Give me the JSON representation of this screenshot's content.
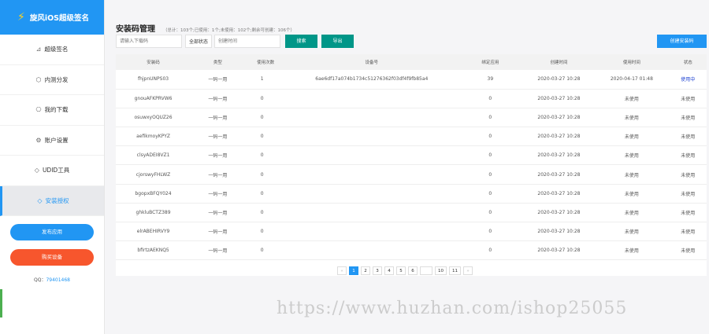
{
  "brand": {
    "title": "旋风iOS超级签名"
  },
  "sidebar": {
    "items": [
      {
        "label": "超级签名",
        "icon": "⊿"
      },
      {
        "label": "内测分发",
        "icon": "⬡"
      },
      {
        "label": "我的下载",
        "icon": "⎔"
      },
      {
        "label": "账户设置",
        "icon": "⚙"
      },
      {
        "label": "UDID工具",
        "icon": "◇"
      },
      {
        "label": "安装授权",
        "icon": "◇"
      }
    ],
    "publish_label": "发布应用",
    "buy_label": "购买设备",
    "qq_label": "QQ：",
    "qq_value": "79401468"
  },
  "page": {
    "title": "安装码管理",
    "stats": "（总计：103个;已使用：1个;未使用：102个;剩余可创建：106个）"
  },
  "toolbar": {
    "code_placeholder": "请输入下载码",
    "status_value": "全部状态",
    "time_placeholder": "创建时间",
    "search_label": "搜索",
    "export_label": "导出",
    "create_label": "创建安装码"
  },
  "table": {
    "headers": [
      "安装码",
      "类型",
      "使用次数",
      "设备号",
      "绑定应用",
      "创建时间",
      "使用时间",
      "状态"
    ],
    "rows": [
      [
        "fhjpnUNPS03",
        "一码一用",
        "1",
        "6ae6df17a074b1734c51276362f03df4f9fb85a4",
        "39",
        "2020-03-27 10:28",
        "2020-04-17 01:48",
        "使用中"
      ],
      [
        "gnouAFKPRVW6",
        "一码一用",
        "0",
        "",
        "0",
        "2020-03-27 10:28",
        "未使用",
        "未使用"
      ],
      [
        "osuwxyOQUZ26",
        "一码一用",
        "0",
        "",
        "0",
        "2020-03-27 10:28",
        "未使用",
        "未使用"
      ],
      [
        "aefikmoyKPYZ",
        "一码一用",
        "0",
        "",
        "0",
        "2020-03-27 10:28",
        "未使用",
        "未使用"
      ],
      [
        "clsyADEI8VZ1",
        "一码一用",
        "0",
        "",
        "0",
        "2020-03-27 10:28",
        "未使用",
        "未使用"
      ],
      [
        "cjorswyFHLWZ",
        "一码一用",
        "0",
        "",
        "0",
        "2020-03-27 10:28",
        "未使用",
        "未使用"
      ],
      [
        "bgopxBFQY024",
        "一码一用",
        "0",
        "",
        "0",
        "2020-03-27 10:28",
        "未使用",
        "未使用"
      ],
      [
        "ghkluBCTZ389",
        "一码一用",
        "0",
        "",
        "0",
        "2020-03-27 10:28",
        "未使用",
        "未使用"
      ],
      [
        "elrABEHIRVY9",
        "一码一用",
        "0",
        "",
        "0",
        "2020-03-27 10:28",
        "未使用",
        "未使用"
      ],
      [
        "bfirtzAEKNQ5",
        "一码一用",
        "0",
        "",
        "0",
        "2020-03-27 10:28",
        "未使用",
        "未使用"
      ]
    ]
  },
  "pagination": {
    "prev": "«",
    "pages": [
      "1",
      "2",
      "3",
      "4",
      "5",
      "6",
      "",
      "10",
      "11"
    ],
    "next": "»",
    "active": "1"
  },
  "watermark": "https://www.huzhan.com/ishop25055",
  "colors": {
    "primary": "#2196f3",
    "teal": "#009688",
    "orange": "#f7562d",
    "status_used": "#1a3fd1"
  }
}
